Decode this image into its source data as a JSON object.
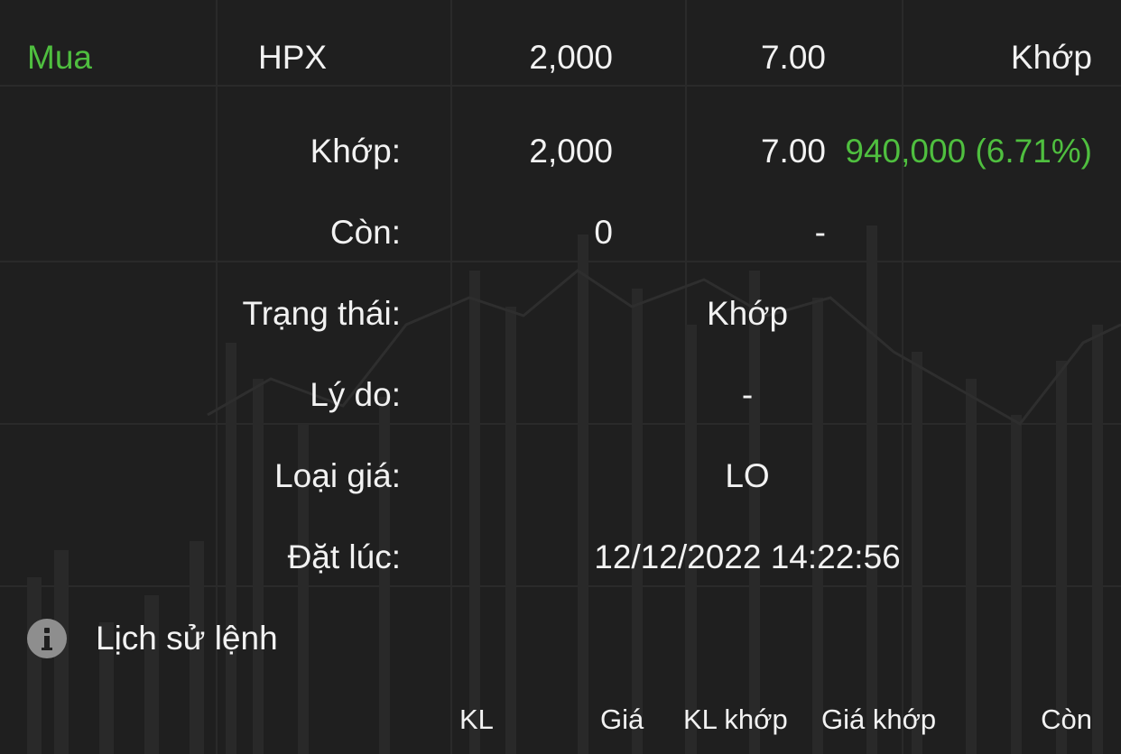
{
  "order": {
    "side": "Mua",
    "symbol": "HPX",
    "quantity": "2,000",
    "price": "7.00",
    "status": "Khớp"
  },
  "details": {
    "matched_label": "Khớp:",
    "matched_qty": "2,000",
    "matched_price": "7.00",
    "matched_value": "940,000 (6.71%)",
    "remaining_label": "Còn:",
    "remaining_qty": "0",
    "remaining_price": "-",
    "state_label": "Trạng thái:",
    "state_value": "Khớp",
    "reason_label": "Lý do:",
    "reason_value": "-",
    "price_type_label": "Loại giá:",
    "price_type_value": "LO",
    "placed_at_label": "Đặt lúc:",
    "placed_at_value": "12/12/2022 14:22:56"
  },
  "history": {
    "title": "Lịch sử lệnh",
    "icon": "info-icon",
    "columns": [
      "KL",
      "Giá",
      "KL khớp",
      "Giá khớp",
      "Còn"
    ]
  },
  "colors": {
    "background": "#1f1f1f",
    "text": "#f2f2f2",
    "buy_green": "#4fbf3f",
    "icon_gray": "#8e8e8e"
  }
}
